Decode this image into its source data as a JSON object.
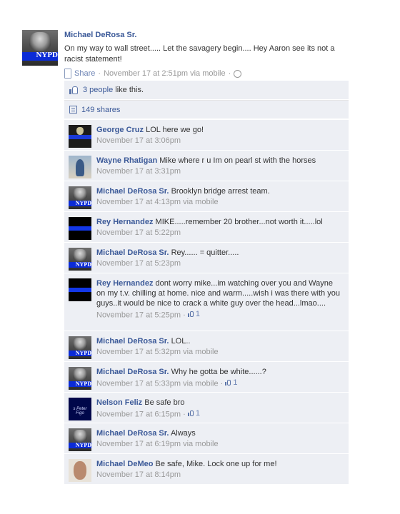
{
  "post": {
    "author": "Michael DeRosa Sr.",
    "avatar_label": "NYPD",
    "text": "On my way to wall street..... Let the savagery begin.... Hey Aaron see its not a racist statement!",
    "share_label": "Share",
    "separator": "·",
    "timestamp": "November 17 at 2:51pm via mobile",
    "icons": [
      "phone-icon",
      "globe-icon"
    ]
  },
  "likes": {
    "count_link": "3 people",
    "suffix": "like this."
  },
  "shares": {
    "label": "149 shares"
  },
  "comments": [
    {
      "author": "George Cruz",
      "text": "LOL here we go!",
      "meta": "November 17 at 3:06pm",
      "likes": "",
      "avatar": "badge"
    },
    {
      "author": "Wayne Rhatigan",
      "text": "Mike where r u Im on pearl st with the horses",
      "meta": "November 17 at 3:31pm",
      "likes": "",
      "avatar": "person"
    },
    {
      "author": "Michael DeRosa Sr.",
      "text": "Brooklyn bridge arrest team.",
      "meta": "November 17 at 4:13pm via mobile",
      "likes": "",
      "avatar": "nypd"
    },
    {
      "author": "Rey Hernandez",
      "text": "MIKE.....remember 20 brother...not worth it.....lol",
      "meta": "November 17 at 5:22pm",
      "likes": "",
      "avatar": "line"
    },
    {
      "author": "Michael DeRosa Sr.",
      "text": "Rey...... = quitter.....",
      "meta": "November 17 at 5:23pm",
      "likes": "",
      "avatar": "nypd"
    },
    {
      "author": "Rey Hernandez",
      "text": "dont worry mike...im watching over you and Wayne on my t.v. chilling at home. nice and warm.....wish i was there with you guys..it would be nice to crack a white guy over the head...lmao....",
      "meta": "November 17 at 5:25pm",
      "likes": "1",
      "avatar": "line"
    },
    {
      "author": "Michael DeRosa Sr.",
      "text": "LOL..",
      "meta": "November 17 at 5:32pm via mobile",
      "likes": "",
      "avatar": "nypd"
    },
    {
      "author": "Michael DeRosa Sr.",
      "text": "Why he gotta be white......?",
      "meta": "November 17 at 5:33pm via mobile",
      "likes": "1",
      "avatar": "nypd"
    },
    {
      "author": "Nelson Feliz",
      "text": "Be safe bro",
      "meta": "November 17 at 6:15pm",
      "likes": "1",
      "avatar": "fig"
    },
    {
      "author": "Michael DeRosa Sr.",
      "text": "Always",
      "meta": "November 17 at 6:19pm via mobile",
      "likes": "",
      "avatar": "nypd"
    },
    {
      "author": "Michael DeMeo",
      "text": "Be safe, Mike. Lock one up for me!",
      "meta": "November 17 at 8:14pm",
      "likes": "",
      "avatar": "face"
    }
  ],
  "nelson_avatar_text": "s Peter Figo",
  "colors": {
    "link": "#3b5998",
    "ufi_bg": "#edeff4",
    "meta": "#999999",
    "nypd_blue": "#0b2bd6"
  }
}
